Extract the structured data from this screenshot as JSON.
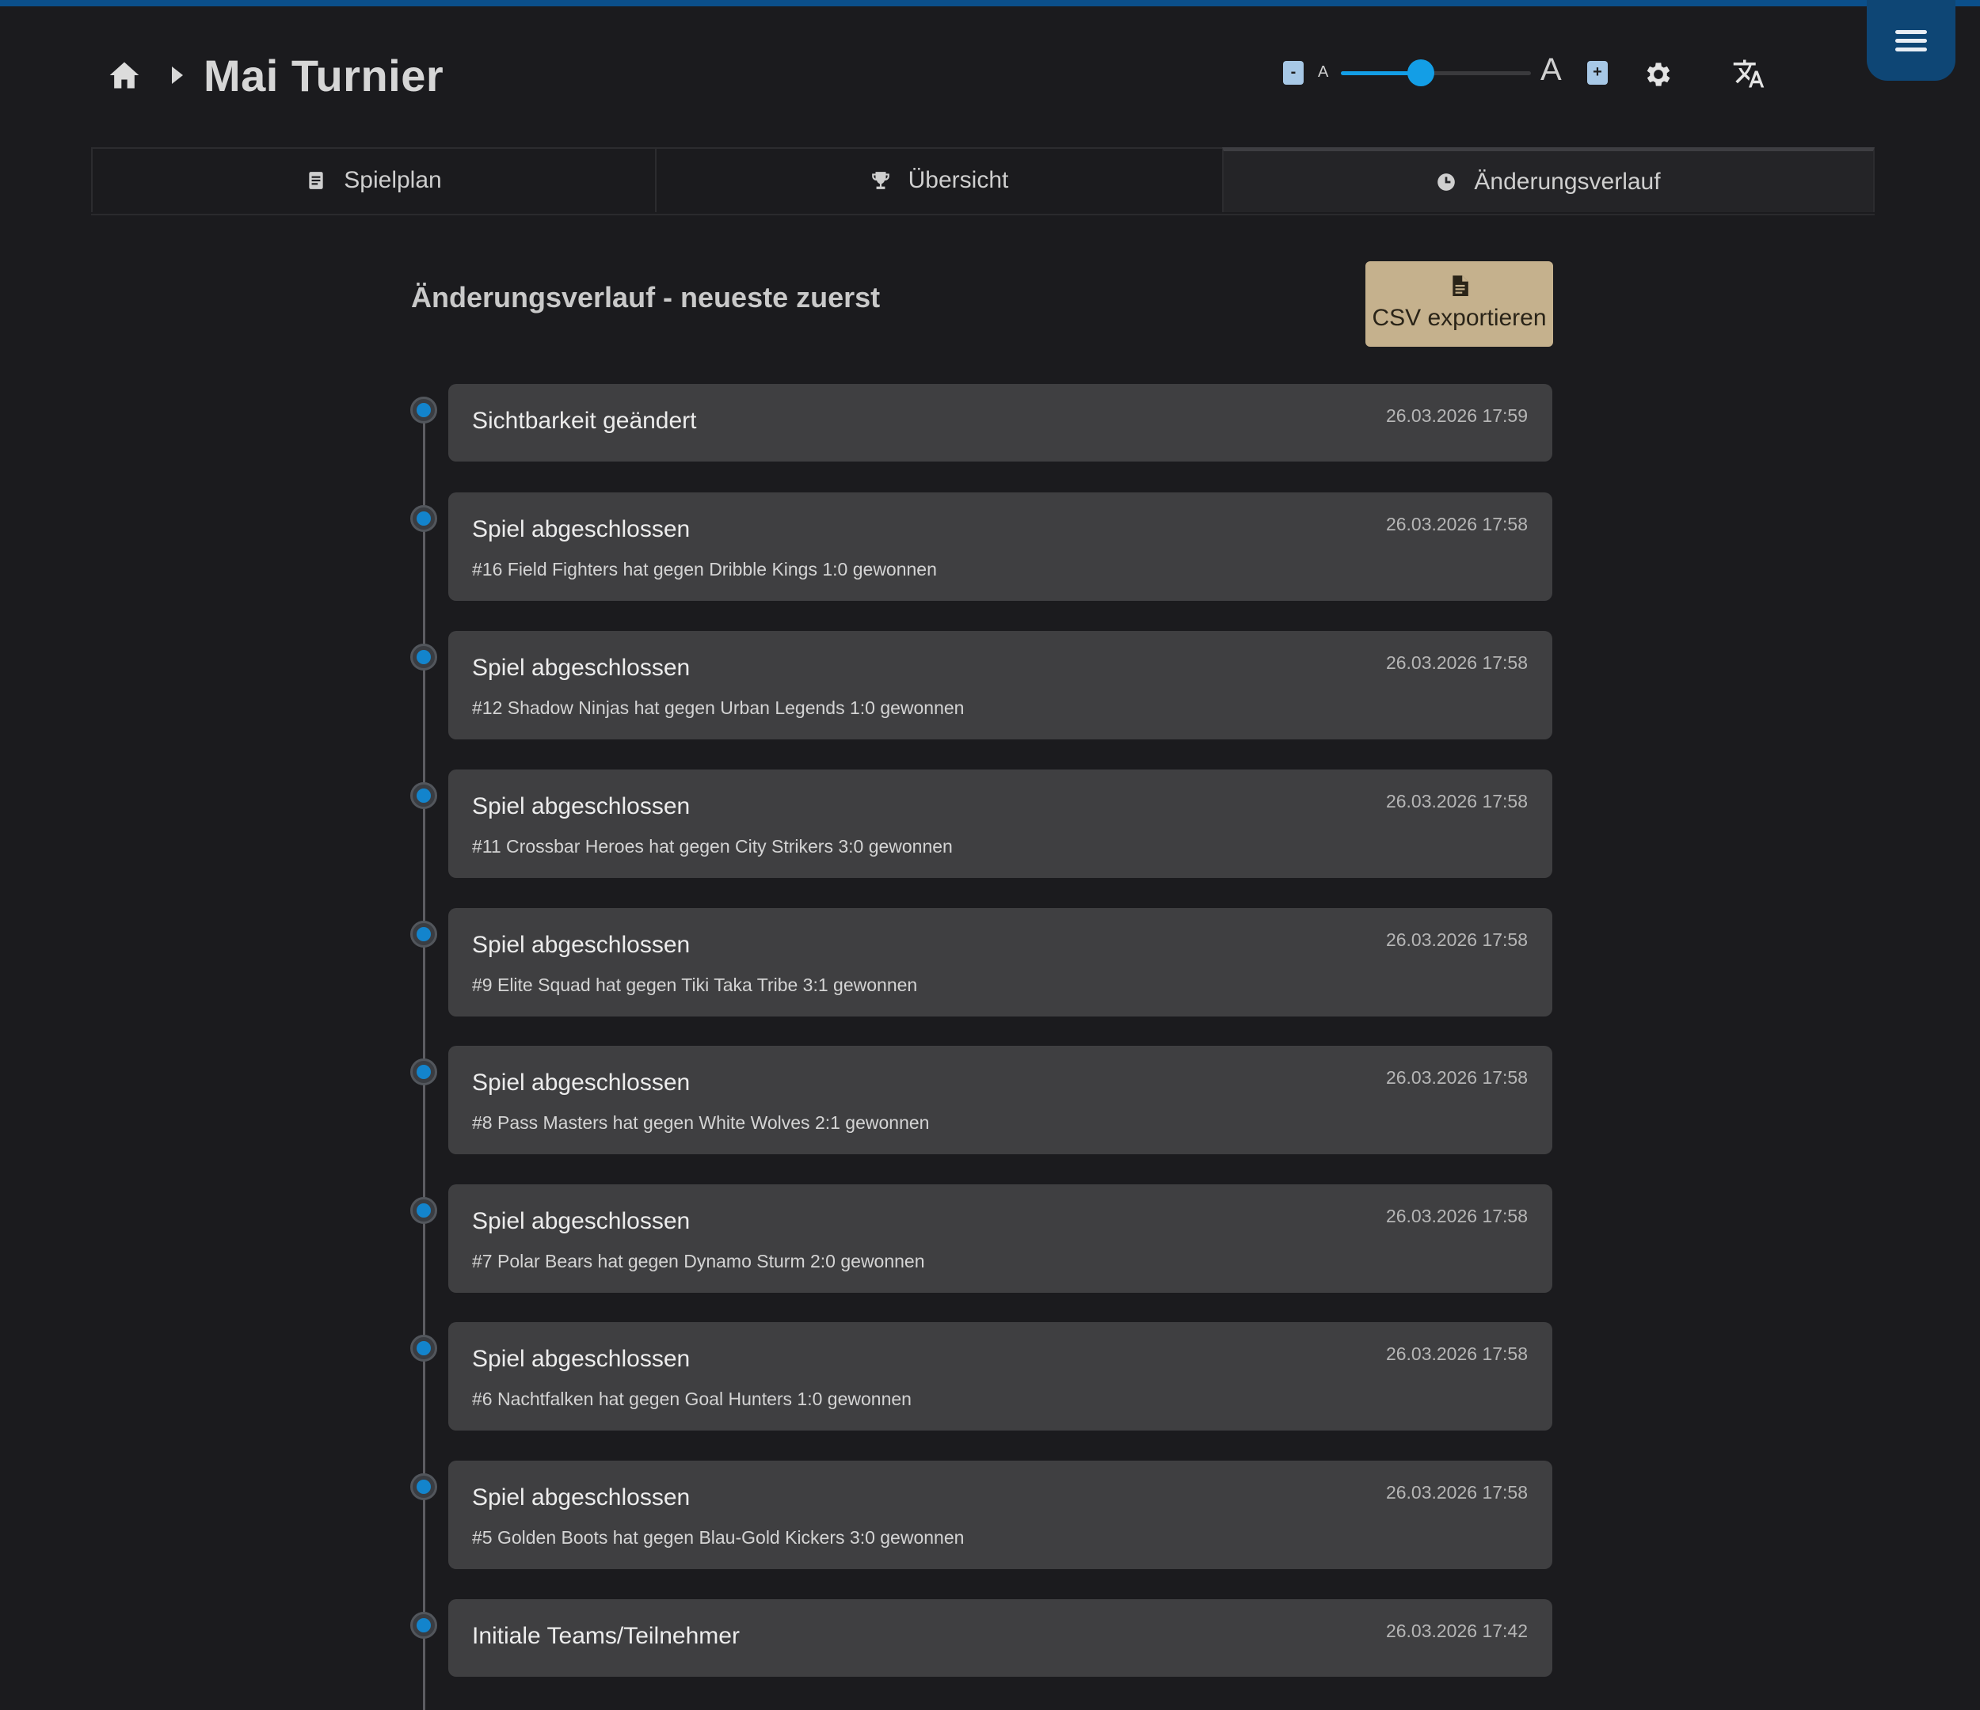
{
  "header": {
    "title": "Mai Turnier"
  },
  "font_size_control": {
    "minus_label": "-",
    "plus_label": "+",
    "small_letter": "A",
    "big_letter": "A",
    "level": 0.42
  },
  "tabs": [
    {
      "label": "Spielplan",
      "icon": "schedule-icon",
      "active": false
    },
    {
      "label": "Übersicht",
      "icon": "trophy-icon",
      "active": false
    },
    {
      "label": "Änderungsverlauf",
      "icon": "clock-icon",
      "active": true
    }
  ],
  "content": {
    "section_title": "Änderungsverlauf - neueste zuerst",
    "export_button": "CSV exportieren"
  },
  "history": [
    {
      "title": "Sichtbarkeit geändert",
      "description": "",
      "time": "26.03.2026 17:59"
    },
    {
      "title": "Spiel abgeschlossen",
      "description": "#16 Field Fighters hat gegen Dribble Kings 1:0 gewonnen",
      "time": "26.03.2026 17:58"
    },
    {
      "title": "Spiel abgeschlossen",
      "description": "#12 Shadow Ninjas hat gegen Urban Legends 1:0 gewonnen",
      "time": "26.03.2026 17:58"
    },
    {
      "title": "Spiel abgeschlossen",
      "description": "#11 Crossbar Heroes hat gegen City Strikers 3:0 gewonnen",
      "time": "26.03.2026 17:58"
    },
    {
      "title": "Spiel abgeschlossen",
      "description": "#9 Elite Squad hat gegen Tiki Taka Tribe 3:1 gewonnen",
      "time": "26.03.2026 17:58"
    },
    {
      "title": "Spiel abgeschlossen",
      "description": "#8 Pass Masters hat gegen White Wolves 2:1 gewonnen",
      "time": "26.03.2026 17:58"
    },
    {
      "title": "Spiel abgeschlossen",
      "description": "#7 Polar Bears hat gegen Dynamo Sturm 2:0 gewonnen",
      "time": "26.03.2026 17:58"
    },
    {
      "title": "Spiel abgeschlossen",
      "description": "#6 Nachtfalken hat gegen Goal Hunters 1:0 gewonnen",
      "time": "26.03.2026 17:58"
    },
    {
      "title": "Spiel abgeschlossen",
      "description": "#5 Golden Boots hat gegen Blau-Gold Kickers 3:0 gewonnen",
      "time": "26.03.2026 17:58"
    },
    {
      "title": "Initiale Teams/Teilnehmer",
      "description": "",
      "time": "26.03.2026 17:42"
    }
  ],
  "colors": {
    "accent": "#139ee6",
    "topbar": "#0b4f8a",
    "export_button": "#c5b18d",
    "card": "#3f3f41",
    "background": "#1b1b1e"
  }
}
